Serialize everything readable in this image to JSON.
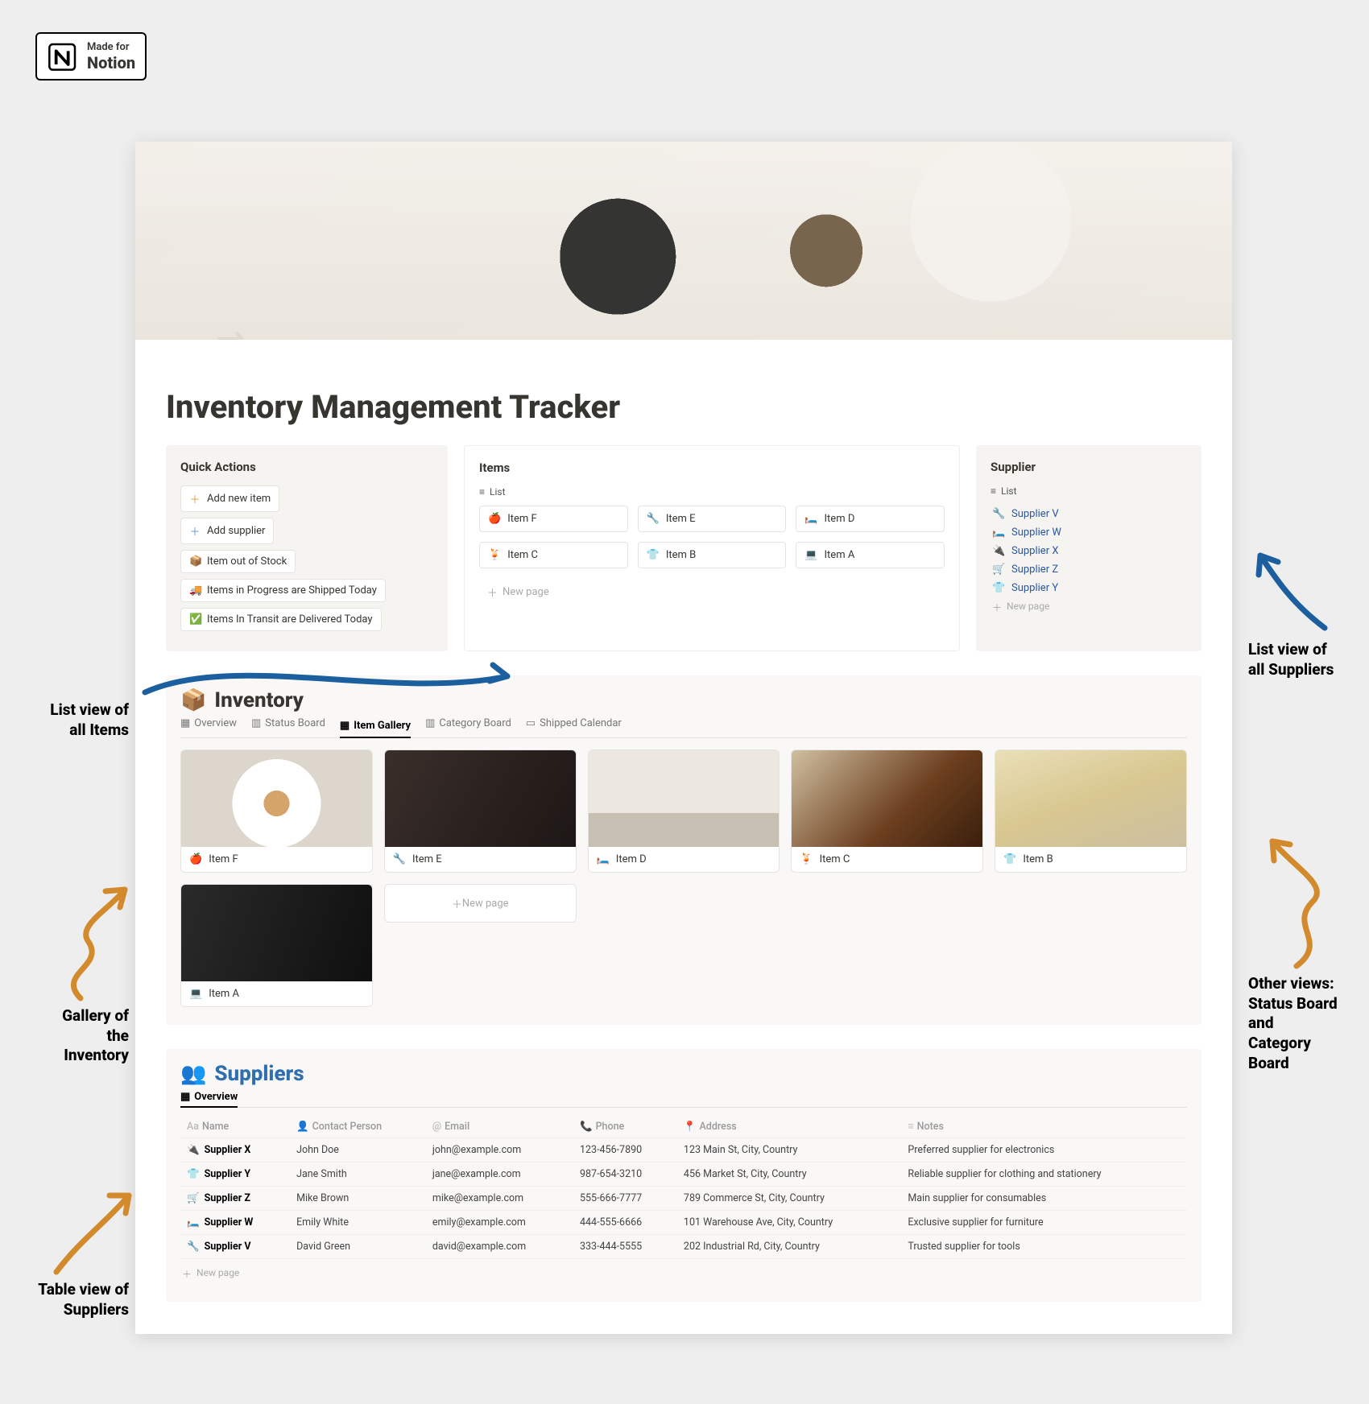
{
  "badge": {
    "line1": "Made for",
    "line2": "Notion"
  },
  "page": {
    "title": "Inventory Management Tracker"
  },
  "quickActions": {
    "title": "Quick Actions",
    "buttons": [
      {
        "icon": "＋",
        "label": "Add new item",
        "iconColor": "#e09b3d"
      },
      {
        "icon": "＋",
        "label": "Add supplier",
        "iconColor": "#5a9bd5"
      },
      {
        "icon": "📦",
        "label": "Item out of Stock"
      },
      {
        "icon": "🚚",
        "label": "Items in Progress are Shipped Today"
      },
      {
        "icon": "✅",
        "label": "Items In Transit are Delivered Today"
      }
    ]
  },
  "itemsPanel": {
    "title": "Items",
    "viewLabel": "List",
    "items": [
      {
        "icon": "🍎",
        "label": "Item F"
      },
      {
        "icon": "🔧",
        "label": "Item E"
      },
      {
        "icon": "🛏️",
        "label": "Item D"
      },
      {
        "icon": "🍹",
        "label": "Item C"
      },
      {
        "icon": "👕",
        "label": "Item B"
      },
      {
        "icon": "💻",
        "label": "Item A"
      }
    ],
    "newPage": "New page"
  },
  "supplierPanel": {
    "title": "Supplier",
    "viewLabel": "List",
    "rows": [
      {
        "icon": "🔧",
        "label": "Supplier V"
      },
      {
        "icon": "🛏️",
        "label": "Supplier W"
      },
      {
        "icon": "🔌",
        "label": "Supplier X"
      },
      {
        "icon": "🛒",
        "label": "Supplier Z"
      },
      {
        "icon": "👕",
        "label": "Supplier Y"
      }
    ],
    "newPage": "New page"
  },
  "inventory": {
    "icon": "📦",
    "title": "Inventory",
    "tabs": [
      {
        "icon": "▦",
        "label": "Overview"
      },
      {
        "icon": "▥",
        "label": "Status Board"
      },
      {
        "icon": "▦",
        "label": "Item Gallery",
        "active": true
      },
      {
        "icon": "▥",
        "label": "Category Board"
      },
      {
        "icon": "▭",
        "label": "Shipped Calendar"
      }
    ],
    "cards": [
      {
        "icon": "🍎",
        "label": "Item F"
      },
      {
        "icon": "🔧",
        "label": "Item E"
      },
      {
        "icon": "🛏️",
        "label": "Item D"
      },
      {
        "icon": "🍹",
        "label": "Item C"
      },
      {
        "icon": "👕",
        "label": "Item B"
      }
    ],
    "cards2": [
      {
        "icon": "💻",
        "label": "Item A"
      }
    ],
    "newPage": "New page"
  },
  "suppliers": {
    "icon": "👥",
    "title": "Suppliers",
    "tab": "Overview",
    "headers": {
      "name": "Name",
      "contact": "Contact Person",
      "email": "Email",
      "phone": "Phone",
      "address": "Address",
      "notes": "Notes"
    },
    "rows": [
      {
        "icon": "🔌",
        "name": "Supplier X",
        "contact": "John Doe",
        "email": "john@example.com",
        "phone": "123-456-7890",
        "address": "123 Main St, City, Country",
        "notes": "Preferred supplier for electronics"
      },
      {
        "icon": "👕",
        "name": "Supplier Y",
        "contact": "Jane Smith",
        "email": "jane@example.com",
        "phone": "987-654-3210",
        "address": "456 Market St, City, Country",
        "notes": "Reliable supplier for clothing and stationery"
      },
      {
        "icon": "🛒",
        "name": "Supplier Z",
        "contact": "Mike Brown",
        "email": "mike@example.com",
        "phone": "555-666-7777",
        "address": "789 Commerce St, City, Country",
        "notes": "Main supplier for consumables"
      },
      {
        "icon": "🛏️",
        "name": "Supplier W",
        "contact": "Emily White",
        "email": "emily@example.com",
        "phone": "444-555-6666",
        "address": "101 Warehouse Ave, City, Country",
        "notes": "Exclusive supplier for furniture"
      },
      {
        "icon": "🔧",
        "name": "Supplier V",
        "contact": "David Green",
        "email": "david@example.com",
        "phone": "333-444-5555",
        "address": "202 Industrial Rd, City, Country",
        "notes": "Trusted supplier for tools"
      }
    ],
    "newPage": "New page"
  },
  "annotations": {
    "a1": "List view of\nall Items",
    "a2": "Gallery of\nthe\nInventory",
    "a3": "Table view of\nSuppliers",
    "a4": "List view of\nall Suppliers",
    "a5": "Other views:\nStatus Board\nand\nCategory\nBoard"
  }
}
